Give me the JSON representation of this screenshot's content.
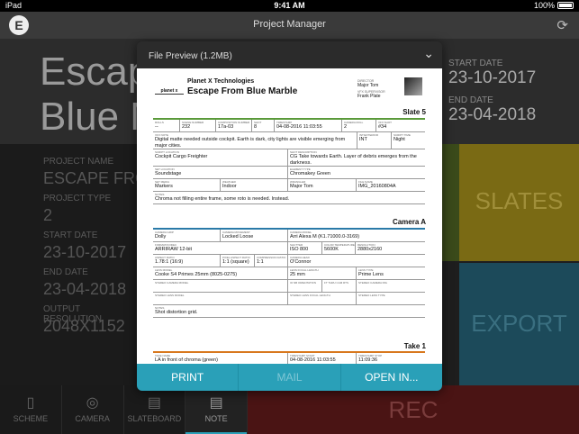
{
  "statusbar": {
    "carrier": "iPad",
    "time": "9:41 AM",
    "battery": "100%"
  },
  "nav": {
    "title": "Project Manager",
    "logo": "E"
  },
  "hero": {
    "title_line1": "Escape",
    "title_line2": "Blue M",
    "start_label": "START DATE",
    "start_value": "23-10-2017",
    "end_label": "END DATE",
    "end_value": "23-04-2018"
  },
  "info": {
    "name_label": "PROJECT NAME",
    "name_value": "ESCAPE FRO",
    "type_label": "PROJECT TYPE",
    "type_value": "2",
    "start_label": "START DATE",
    "start_value": "23-10-2017",
    "end_label": "END DATE",
    "end_value": "23-04-2018",
    "res_label": "OUTPUT RESOLUTION",
    "res_value": "2048X1152"
  },
  "tiles": {
    "slates": "SLATES",
    "export": "EXPORT",
    "rec": "REC"
  },
  "tabs": [
    {
      "label": "SCHEME",
      "icon": "scheme-icon",
      "glyph": "▯"
    },
    {
      "label": "CAMERA",
      "icon": "camera-icon",
      "glyph": "◎"
    },
    {
      "label": "SLATEBOARD",
      "icon": "clapper-icon",
      "glyph": "▤"
    },
    {
      "label": "NOTE",
      "icon": "note-icon",
      "glyph": "▤"
    }
  ],
  "modal": {
    "title": "File Preview (1.2MB)",
    "actions": {
      "print": "PRINT",
      "mail": "MAIL",
      "open": "OPEN IN..."
    }
  },
  "doc": {
    "brand": "planet x",
    "company": "Planet X Technologies",
    "project": "Escape From Blue Marble",
    "director_label": "DIRECTOR",
    "director": "Major Tom",
    "vfx_label": "VFX SUPERVISOR",
    "vfx": "Frank Plate",
    "slate_title": "Slate 5",
    "slate_rows": [
      [
        {
          "k": "ROLLS",
          "v": "--",
          "w": 30
        },
        {
          "k": "SCENE NUMBER",
          "v": "232",
          "w": 40
        },
        {
          "k": "COMPOSITION NUMBER",
          "v": "17a-03",
          "w": 40
        },
        {
          "k": "SHOT",
          "v": "8",
          "w": 25
        },
        {
          "k": "TIMESTAMP",
          "v": "04-08-2016 11:03:55",
          "w": 75
        },
        {
          "k": "CAMERA ROLL",
          "v": "2",
          "w": 38
        },
        {
          "k": "VFX SHOT",
          "v": "#34",
          "w": 54
        }
      ],
      [
        {
          "k": "VFX NOTE",
          "v": "Digital matte needed outside cockpit. Earth is dark, city lights are visible emerging from major cities.",
          "w": 227,
          "tall": true
        },
        {
          "k": "INT/EXTERIOR",
          "v": "INT",
          "w": 38,
          "tall": true
        },
        {
          "k": "SCRIPT TIME",
          "v": "Night",
          "w": 37,
          "tall": true
        }
      ],
      [
        {
          "k": "SCRIPT LOCATION",
          "v": "Cockpit Cargo Freighter",
          "w": 150,
          "tall": true
        },
        {
          "k": "SHOT DESCRIPTION",
          "v": "CG Take towards Earth. Layer of debris emerges from the darkness.",
          "w": 152,
          "tall": true
        }
      ],
      [
        {
          "k": "SET LOCATION",
          "v": "Soundstage",
          "w": 150
        },
        {
          "k": "ELEMENT TYPE",
          "v": "Chromakey Green",
          "w": 152
        }
      ],
      [
        {
          "k": "SET MEDIA",
          "v": "Markers",
          "w": 75
        },
        {
          "k": "WEATHER",
          "v": "Indoor",
          "w": 75
        },
        {
          "k": "WRANGLER",
          "v": "Major Tom",
          "w": 76
        },
        {
          "k": "FILE NAME",
          "v": "IMG_20160804A",
          "w": 76
        }
      ],
      [
        {
          "k": "NOTES",
          "v": "Chroma not filling entire frame, some roto is needed. Instead.",
          "w": 302
        }
      ]
    ],
    "camera_title": "Camera A",
    "camera_rows": [
      [
        {
          "k": "CAMERA GRIP",
          "v": "Dolly",
          "w": 75
        },
        {
          "k": "CAMERA MOVEMENT",
          "v": "Locked Loose",
          "w": 75
        },
        {
          "k": "CAMERA MODEL",
          "v": "Arri Alexa M (K1.71000.0-3169)",
          "w": 152
        }
      ],
      [
        {
          "k": "FORMAT/CODEC",
          "v": "ARRIRAW 12-bit",
          "w": 150
        },
        {
          "k": "SHUTTER",
          "v": "ISO 800",
          "w": 38
        },
        {
          "k": "COLOR TEMPERATURE",
          "v": "5600K",
          "w": 37
        },
        {
          "k": "RESOLUTION",
          "v": "2880x2160",
          "w": 77
        }
      ],
      [
        {
          "k": "ASPECT RATIO",
          "v": "1.78:1 (16:9)",
          "w": 75
        },
        {
          "k": "PIXEL ASPECT RATIO",
          "v": "1:1 (square)",
          "w": 38
        },
        {
          "k": "COMPRESSION RATIO",
          "v": "1:1",
          "w": 37
        },
        {
          "k": "CAMERA HEAD",
          "v": "O'Connor",
          "w": 152
        }
      ],
      [
        {
          "k": "LENS MODEL",
          "v": "Cooke S4 Primes 25mm (8025-0275)",
          "w": 150
        },
        {
          "k": "LENS FOCAL LENGTH",
          "v": "25 mm",
          "w": 76
        },
        {
          "k": "LENS TYPE",
          "v": "Prime Lens",
          "w": 76
        }
      ],
      [
        {
          "k": "STEREO CAMERA MODEL",
          "v": "",
          "w": 150
        },
        {
          "k": "IO NB ORIENTATION",
          "v": "",
          "w": 38
        },
        {
          "k": "FT THRU CAM RTS",
          "v": "",
          "w": 38
        },
        {
          "k": "STEREO CAMERA RIG",
          "v": "",
          "w": 76
        }
      ],
      [
        {
          "k": "STEREO LENS MODEL",
          "v": "",
          "w": 150
        },
        {
          "k": "STEREO LENS FOCAL LENGTH",
          "v": "",
          "w": 76
        },
        {
          "k": "STEREO LENS TYPE",
          "v": "",
          "w": 76
        }
      ],
      [
        {
          "k": "NOTES",
          "v": "Shot distortion grid.",
          "w": 302
        }
      ]
    ],
    "take_title": "Take 1",
    "take_rows": [
      [
        {
          "k": "TAKE NAME",
          "v": "LA in front of chroma (green)",
          "w": 150
        },
        {
          "k": "TIMESTAMP START",
          "v": "04-08-2016 11:03:55",
          "w": 76
        },
        {
          "k": "TIMESTAMP STOP",
          "v": "11:09:36",
          "w": 76
        }
      ]
    ]
  }
}
